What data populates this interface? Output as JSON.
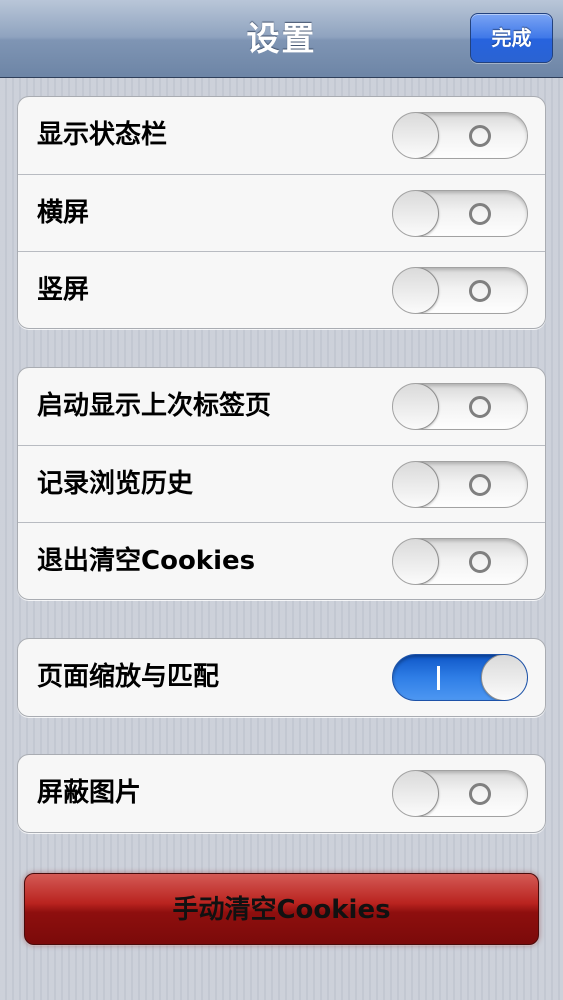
{
  "navbar": {
    "title": "设置",
    "done_label": "完成"
  },
  "groups": [
    {
      "rows": [
        {
          "label": "显示状态栏",
          "toggle_on": false
        },
        {
          "label": "横屏",
          "toggle_on": false
        },
        {
          "label": "竖屏",
          "toggle_on": false
        }
      ]
    },
    {
      "rows": [
        {
          "label": "启动显示上次标签页",
          "toggle_on": false
        },
        {
          "label": "记录浏览历史",
          "toggle_on": false
        },
        {
          "label": "退出清空Cookies",
          "toggle_on": false
        }
      ]
    },
    {
      "rows": [
        {
          "label": "页面缩放与匹配",
          "toggle_on": true
        }
      ]
    },
    {
      "rows": [
        {
          "label": "屏蔽图片",
          "toggle_on": false
        }
      ]
    }
  ],
  "clear_cookies_label": "手动清空Cookies",
  "colors": {
    "navbar": "#8fa3bf",
    "done_button": "#3f78e8",
    "toggle_on": "#2f7ee6",
    "clear_button": "#8e0f0e",
    "background": "#c7ccd6"
  }
}
